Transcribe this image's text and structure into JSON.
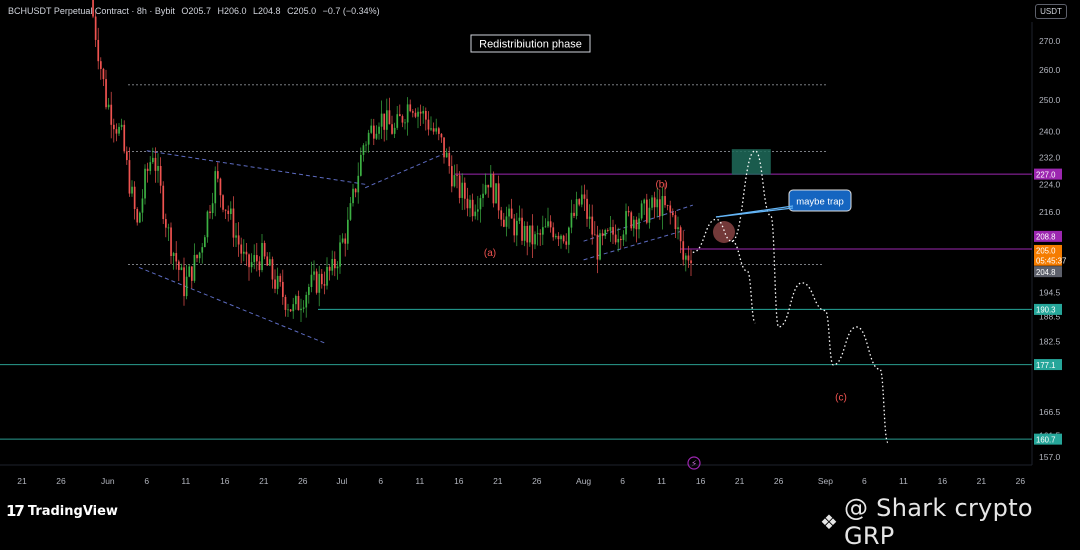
{
  "header": {
    "symbol": "BCHUSDT Perpetual Contract · 8h · Bybit",
    "o": "O205.7",
    "h": "H206.0",
    "l": "L204.8",
    "c": "C205.0",
    "change": "−0.7 (−0.34%)",
    "currency": "USDT"
  },
  "logo": {
    "mark": "17",
    "text": "TradingView"
  },
  "watermark": {
    "icon": "shark-diamond-icon",
    "text": "@ Shark crypto GRP"
  },
  "colors": {
    "background": "#000000",
    "up": "#26a69a",
    "up_candle": "#3cb043",
    "down": "#ef5350",
    "purple_level": "#9c27b0",
    "teal_level": "#26a69a",
    "cyan_level": "#2a9d8f",
    "projection": "#ffffff",
    "zone": "#1e6b5a"
  },
  "chart_data": {
    "type": "candlestick",
    "title": "Redistribiution phase",
    "timeframe": "8h",
    "exchange": "Bybit",
    "x_tick_labels": [
      "21",
      "26",
      "Jun",
      "6",
      "11",
      "16",
      "21",
      "26",
      "Jul",
      "6",
      "11",
      "16",
      "21",
      "26",
      "Aug",
      "6",
      "11",
      "16",
      "21",
      "26",
      "Sep",
      "6",
      "11",
      "16",
      "21",
      "26"
    ],
    "y_ticks": [
      270.0,
      260.0,
      250.0,
      240.0,
      232.0,
      224.0,
      216.0,
      200.5,
      194.5,
      188.5,
      182.5,
      176.5,
      166.5,
      161.5,
      157.0
    ],
    "y_tick_labels": [
      "270.0",
      "260.0",
      "250.0",
      "240.0",
      "232.0",
      "224.0",
      "216.0",
      "200.5",
      "194.5",
      "188.5",
      "182.5",
      "176.5",
      "166.5",
      "161.5",
      "157.0"
    ],
    "price_tags": [
      {
        "label": "227.0",
        "role": "resistance"
      },
      {
        "label": "208.8",
        "role": "high"
      },
      {
        "label": "205.0",
        "role": "last"
      },
      {
        "label": "05:45:37",
        "role": "countdown"
      },
      {
        "label": "204.8",
        "role": "low"
      },
      {
        "label": "190.3",
        "role": "support"
      },
      {
        "label": "177.1",
        "role": "support"
      },
      {
        "label": "160.7",
        "role": "support"
      }
    ],
    "levels": [
      {
        "price": 255.0,
        "style": "dotted",
        "color": "grey"
      },
      {
        "price": 233.8,
        "style": "dotted",
        "color": "grey"
      },
      {
        "price": 227.0,
        "style": "solid",
        "color": "purple"
      },
      {
        "price": 205.9,
        "style": "solid",
        "color": "purple"
      },
      {
        "price": 201.8,
        "style": "dotted",
        "color": "grey"
      },
      {
        "price": 190.3,
        "style": "solid",
        "color": "teal"
      },
      {
        "price": 177.1,
        "style": "solid",
        "color": "cyan"
      },
      {
        "price": 160.7,
        "style": "solid",
        "color": "cyan"
      }
    ],
    "annotations": [
      {
        "text": "(a)",
        "color": "red"
      },
      {
        "text": "(b)",
        "color": "red"
      },
      {
        "text": "(c)",
        "color": "red"
      },
      {
        "text": "maybe trap",
        "color": "white"
      }
    ],
    "price_path": [
      {
        "date": "2024-05-30",
        "price": 285
      },
      {
        "date": "2024-06-01",
        "price": 250
      },
      {
        "date": "2024-06-03",
        "price": 238
      },
      {
        "date": "2024-06-05",
        "price": 212
      },
      {
        "date": "2024-06-06",
        "price": 225
      },
      {
        "date": "2024-06-07",
        "price": 234
      },
      {
        "date": "2024-06-09",
        "price": 210
      },
      {
        "date": "2024-06-11",
        "price": 196
      },
      {
        "date": "2024-06-13",
        "price": 205
      },
      {
        "date": "2024-06-15",
        "price": 226
      },
      {
        "date": "2024-06-17",
        "price": 214
      },
      {
        "date": "2024-06-19",
        "price": 201
      },
      {
        "date": "2024-06-21",
        "price": 204
      },
      {
        "date": "2024-06-23",
        "price": 196
      },
      {
        "date": "2024-06-25",
        "price": 190
      },
      {
        "date": "2024-06-27",
        "price": 196
      },
      {
        "date": "2024-06-30",
        "price": 200
      },
      {
        "date": "2024-07-02",
        "price": 212
      },
      {
        "date": "2024-07-04",
        "price": 236
      },
      {
        "date": "2024-07-06",
        "price": 245
      },
      {
        "date": "2024-07-08",
        "price": 240
      },
      {
        "date": "2024-07-10",
        "price": 250
      },
      {
        "date": "2024-07-12",
        "price": 244
      },
      {
        "date": "2024-07-14",
        "price": 236
      },
      {
        "date": "2024-07-16",
        "price": 223
      },
      {
        "date": "2024-07-18",
        "price": 218
      },
      {
        "date": "2024-07-20",
        "price": 226
      },
      {
        "date": "2024-07-22",
        "price": 215
      },
      {
        "date": "2024-07-24",
        "price": 211
      },
      {
        "date": "2024-07-26",
        "price": 208
      },
      {
        "date": "2024-07-28",
        "price": 212
      },
      {
        "date": "2024-07-30",
        "price": 210
      },
      {
        "date": "2024-08-01",
        "price": 220
      },
      {
        "date": "2024-08-03",
        "price": 206
      },
      {
        "date": "2024-08-05",
        "price": 210
      },
      {
        "date": "2024-08-07",
        "price": 214
      },
      {
        "date": "2024-08-09",
        "price": 216
      },
      {
        "date": "2024-08-11",
        "price": 218
      },
      {
        "date": "2024-08-13",
        "price": 214
      },
      {
        "date": "2024-08-14",
        "price": 203
      },
      {
        "date": "2024-08-15",
        "price": 205
      }
    ],
    "projection_path": [
      {
        "date": "2024-08-15",
        "price": 205
      },
      {
        "date": "2024-08-18",
        "price": 214
      },
      {
        "date": "2024-08-20",
        "price": 208
      },
      {
        "date": "2024-08-23",
        "price": 234
      },
      {
        "date": "2024-08-25",
        "price": 215
      },
      {
        "date": "2024-08-26",
        "price": 186
      },
      {
        "date": "2024-08-29",
        "price": 197
      },
      {
        "date": "2024-09-01",
        "price": 190
      },
      {
        "date": "2024-09-02",
        "price": 177
      },
      {
        "date": "2024-09-05",
        "price": 186
      },
      {
        "date": "2024-09-08",
        "price": 176
      },
      {
        "date": "2024-09-09",
        "price": 160
      }
    ],
    "alt_projection": [
      {
        "date": "2024-08-20",
        "price": 208
      },
      {
        "date": "2024-08-22",
        "price": 200
      },
      {
        "date": "2024-08-23",
        "price": 187
      }
    ],
    "y_scale": "log",
    "grid": false
  }
}
